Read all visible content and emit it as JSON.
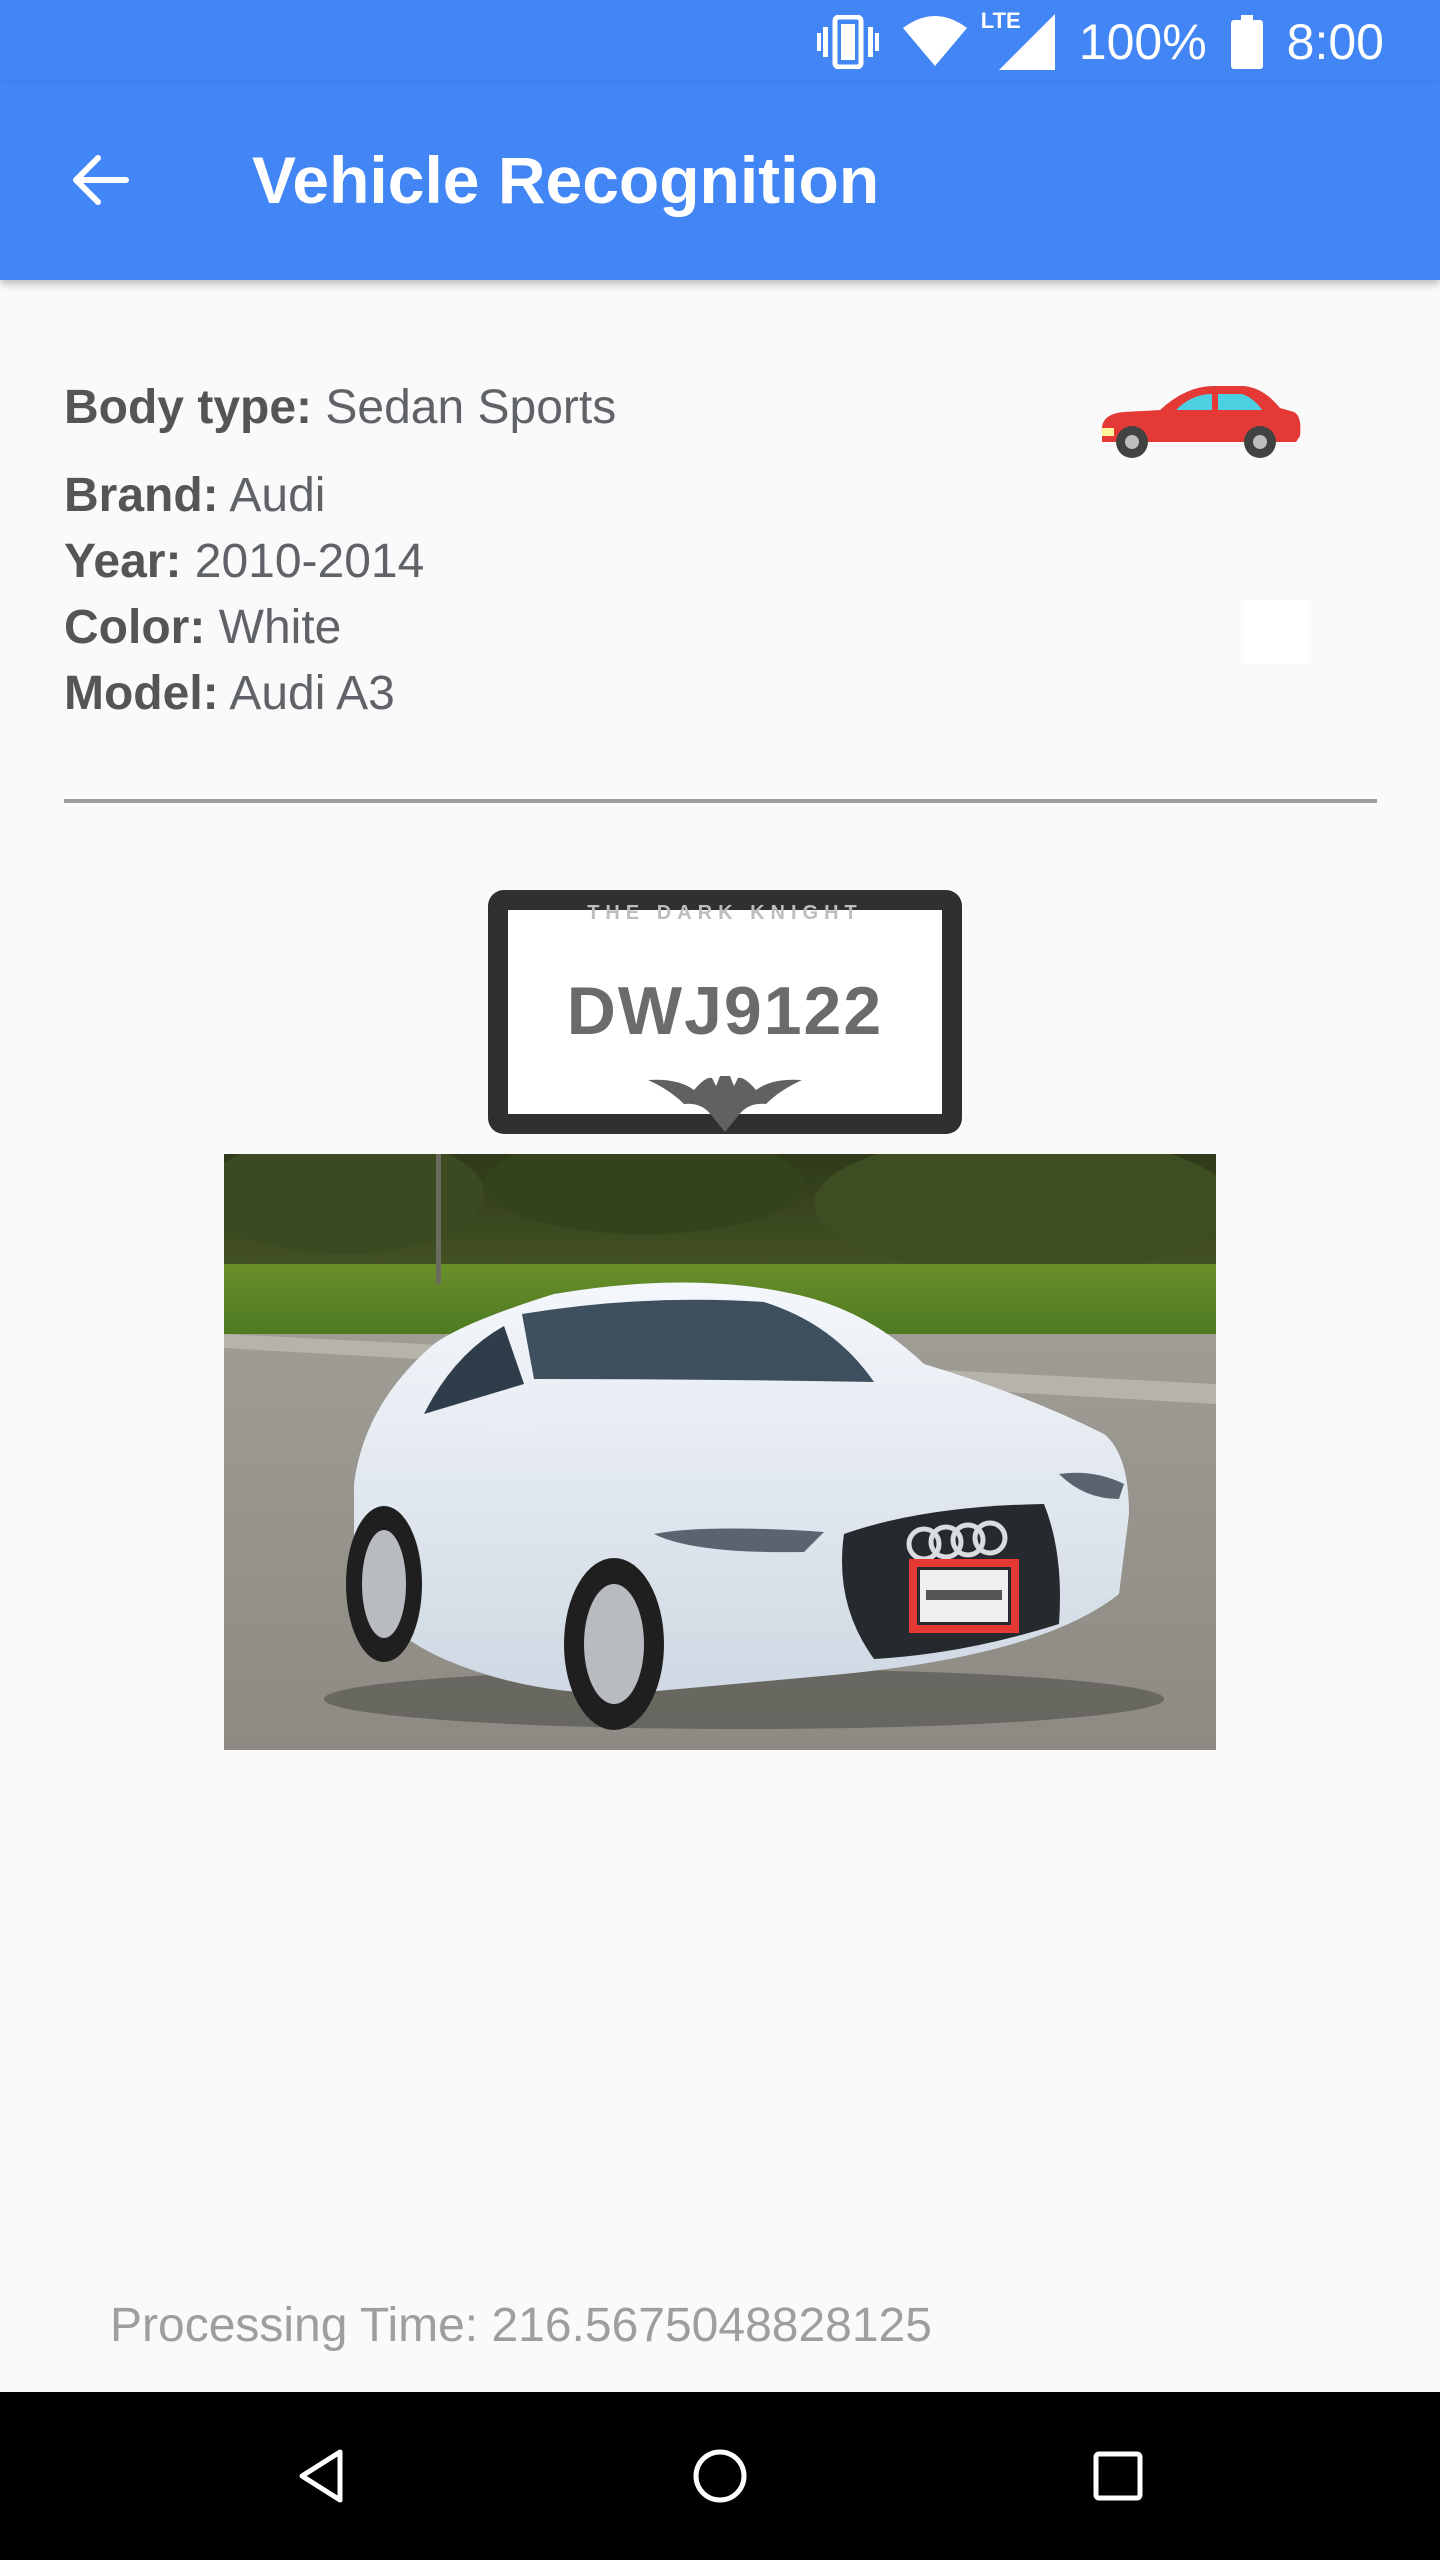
{
  "status_bar": {
    "battery": "100%",
    "time": "8:00",
    "network": "LTE",
    "icons": [
      "vibrate-icon",
      "wifi-icon",
      "lte-signal-icon",
      "battery-icon"
    ]
  },
  "app_bar": {
    "title": "Vehicle Recognition",
    "back_icon": "arrow-back-icon",
    "color": "#4285f4"
  },
  "vehicle": {
    "body_type_label": "Body type:",
    "body_type": "Sedan Sports",
    "brand_label": "Brand:",
    "brand": "Audi",
    "year_label": "Year:",
    "year": "2010-2014",
    "color_label": "Color:",
    "color": "White",
    "color_swatch": "#ffffff",
    "model_label": "Model:",
    "model": "Audi A3",
    "body_icon": "red-sedan-car-icon"
  },
  "plate": {
    "frame_text": "THE DARK KNIGHT",
    "number": "DWJ9122",
    "emblem": "bat-logo"
  },
  "photo": {
    "subject": "white-audi-sedan-photo",
    "plate_highlight_color": "#e53935"
  },
  "footer": {
    "processing_time": "Processing Time: 216.5675048828125"
  },
  "nav": {
    "back_icon": "nav-back-icon",
    "home_icon": "nav-home-icon",
    "recents_icon": "nav-recents-icon"
  }
}
